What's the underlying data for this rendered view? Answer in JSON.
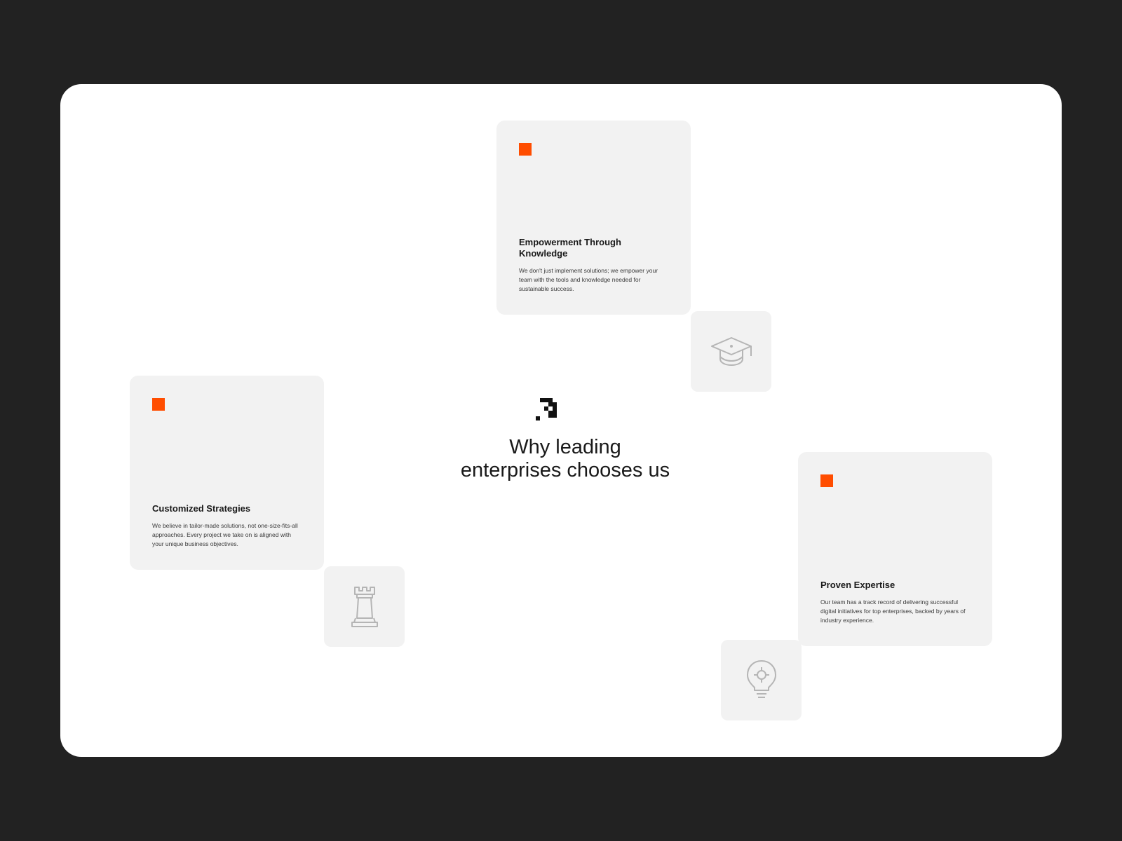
{
  "headline": {
    "line1": "Why leading",
    "line2": "enterprises chooses us"
  },
  "cards": [
    {
      "title": "Empowerment Through Knowledge",
      "description": "We don't just implement solutions; we empower your team with the tools and knowledge needed for sustainable success.",
      "icon": "graduation-cap-icon"
    },
    {
      "title": "Customized Strategies",
      "description": "We believe in tailor-made solutions, not one-size-fits-all approaches. Every project we take on is aligned with your unique business objectives.",
      "icon": "chess-rook-icon"
    },
    {
      "title": "Proven Expertise",
      "description": "Our team has a track record of delivering successful digital initiatives for top enterprises, backed by years of industry experience.",
      "icon": "lightbulb-icon"
    }
  ],
  "colors": {
    "accent": "#ff4d00",
    "background": "#222222",
    "panel": "#ffffff",
    "card": "#f2f2f2",
    "icon_stroke": "#b5b5b5"
  }
}
